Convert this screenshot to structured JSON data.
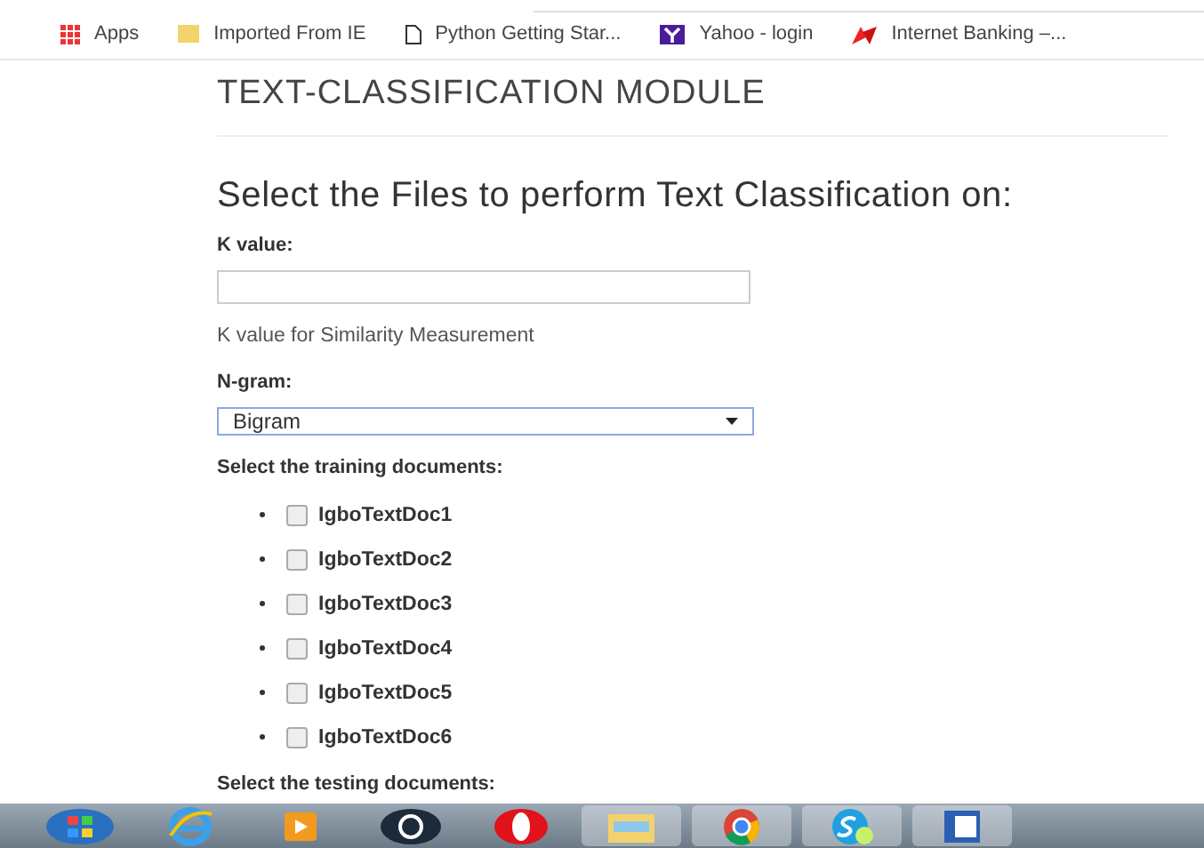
{
  "bookmarks": [
    {
      "label": "Apps",
      "kind": "apps"
    },
    {
      "label": "Imported From IE",
      "kind": "folder"
    },
    {
      "label": "Python Getting Star...",
      "kind": "page"
    },
    {
      "label": "Yahoo - login",
      "kind": "yahoo"
    },
    {
      "label": "Internet Banking –...",
      "kind": "bank"
    }
  ],
  "page_title": "TEXT-CLASSIFICATION MODULE",
  "form": {
    "heading": "Select the Files to perform Text Classification on:",
    "k_label": "K value:",
    "k_help": "K value for Similarity Measurement",
    "ngram_label": "N-gram:",
    "ngram_value": "Bigram",
    "training_label": "Select the training documents:",
    "training_docs": [
      {
        "label": "IgboTextDoc1",
        "checked": false
      },
      {
        "label": "IgboTextDoc2",
        "checked": false
      },
      {
        "label": "IgboTextDoc3",
        "checked": false
      },
      {
        "label": "IgboTextDoc4",
        "checked": false
      },
      {
        "label": "IgboTextDoc5",
        "checked": false
      },
      {
        "label": "IgboTextDoc6",
        "checked": false
      }
    ],
    "testing_label": "Select the testing documents:"
  },
  "taskbar": [
    {
      "kind": "start"
    },
    {
      "kind": "browser"
    },
    {
      "kind": "media"
    },
    {
      "kind": "hp"
    },
    {
      "kind": "opera"
    },
    {
      "kind": "folder"
    },
    {
      "kind": "chrome"
    },
    {
      "kind": "skype"
    },
    {
      "kind": "word"
    }
  ]
}
